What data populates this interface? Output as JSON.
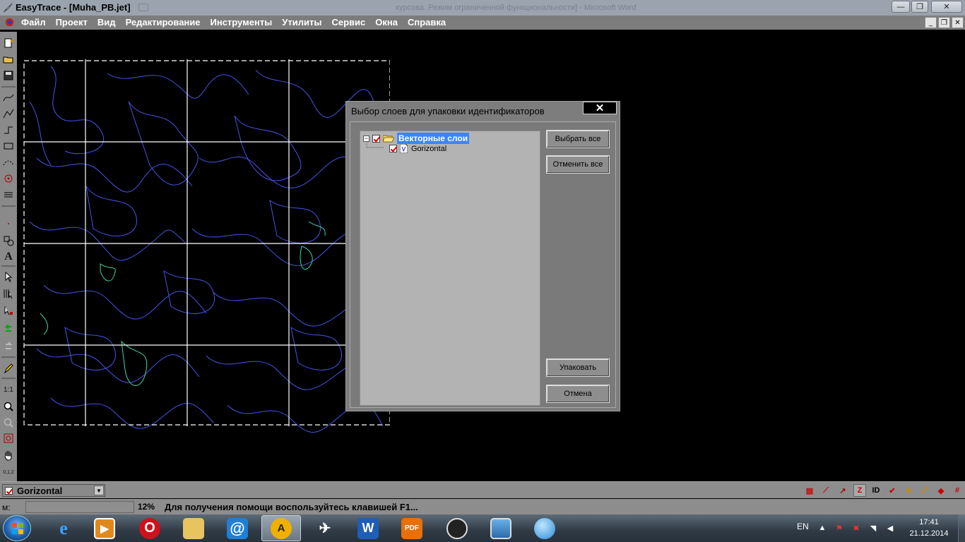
{
  "window": {
    "title": "EasyTrace - [Muha_PB.jet]",
    "background_title": "курсова. Режим ограниченной функциональности] - Microsoft Word"
  },
  "menu": {
    "items": [
      "Файл",
      "Проект",
      "Вид",
      "Редактирование",
      "Инструменты",
      "Утилиты",
      "Сервис",
      "Окна",
      "Справка"
    ]
  },
  "toolbar_left": {
    "scale_label": "1:1",
    "numbers_label": "0,1,2"
  },
  "dialog": {
    "title": "Выбор слоев для упаковки идентификаторов",
    "close_label": "✕",
    "tree": {
      "root_label": "Векторные слои",
      "root_checked": true,
      "children": [
        {
          "label": "Gorizontal",
          "checked": true
        }
      ]
    },
    "buttons": {
      "select_all": "Выбрать все",
      "deselect_all": "Отменить все",
      "pack": "Упаковать",
      "cancel": "Отмена"
    }
  },
  "layer_bar": {
    "current_layer": "Gorizontal",
    "tool_labels": {
      "id": "ID",
      "z": "Z"
    }
  },
  "status_bar": {
    "coord_label": "м:",
    "zoom": "12%",
    "help": "Для получения помощи воспользуйтесь клавишей F1..."
  },
  "taskbar": {
    "language": "EN",
    "time": "17:41",
    "date": "21.12.2014",
    "apps": [
      "internet-explorer",
      "media-player",
      "opera",
      "file-explorer",
      "mail-agent",
      "easytrace",
      "paper-plane-app",
      "microsoft-word",
      "pdf-reader",
      "obs-circle",
      "photo-viewer",
      "globe-browser"
    ]
  },
  "colors": {
    "contour_blue": "#4a52e6",
    "contour_green": "#3fd9a6",
    "selection_blue": "#3b84ff",
    "check_red": "#d00000"
  }
}
